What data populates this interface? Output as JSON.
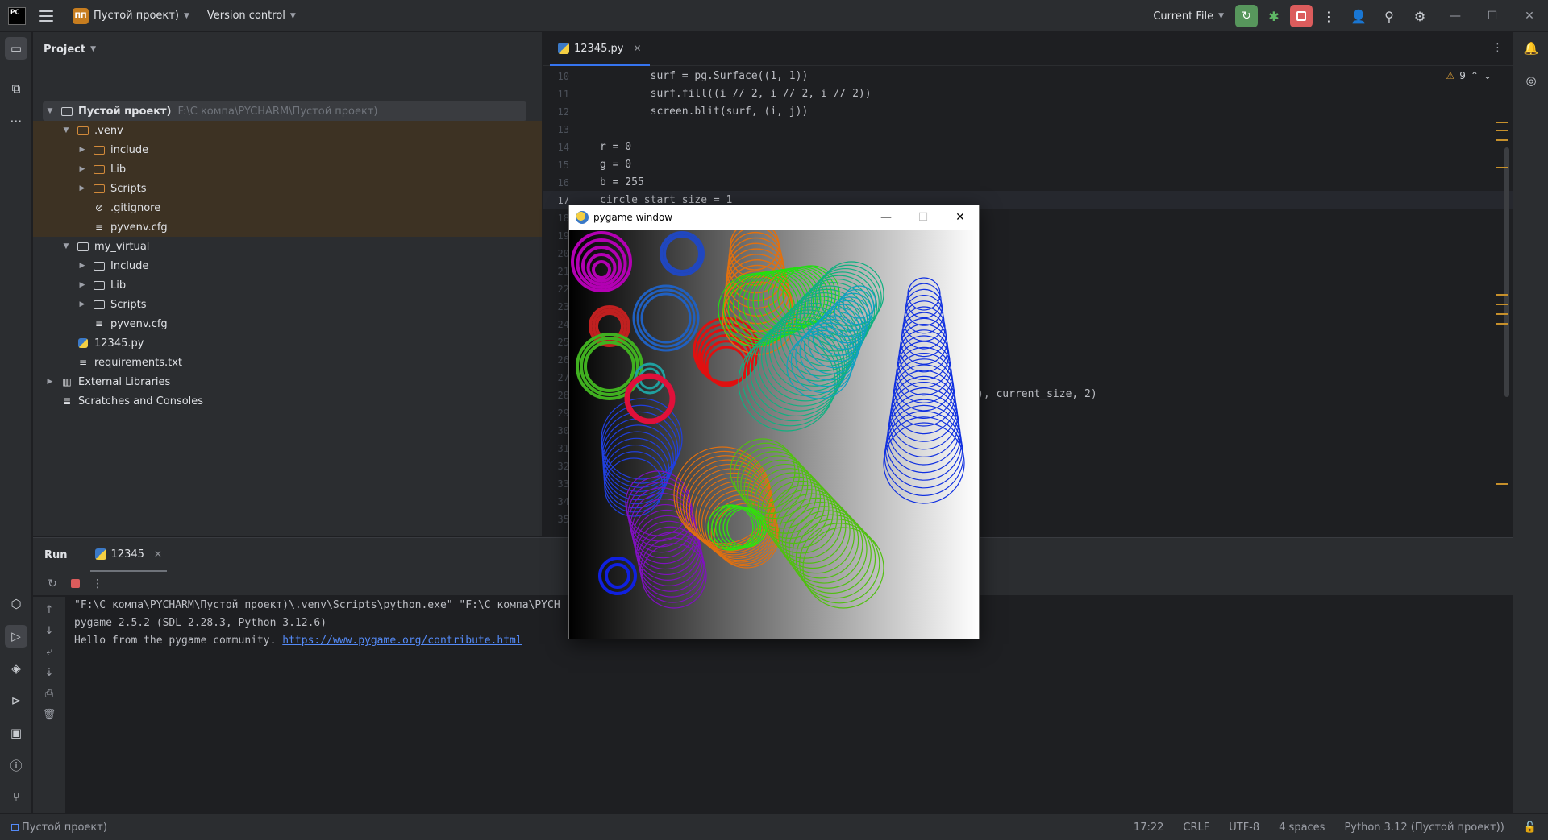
{
  "titlebar": {
    "logo": "PC",
    "project_badge": "ПП",
    "project_name": "Пустой проект)",
    "vcs": "Version control",
    "run_config": "Current File"
  },
  "project_panel": {
    "title": "Project",
    "root": {
      "label": "Пустой проект)",
      "path": "F:\\С компа\\PYCHARM\\Пустой проект)"
    },
    "items": [
      {
        "label": ".venv"
      },
      {
        "label": "include"
      },
      {
        "label": "Lib"
      },
      {
        "label": "Scripts"
      },
      {
        "label": ".gitignore"
      },
      {
        "label": "pyvenv.cfg"
      },
      {
        "label": "my_virtual"
      },
      {
        "label": "Include"
      },
      {
        "label": "Lib"
      },
      {
        "label": "Scripts"
      },
      {
        "label": "pyvenv.cfg"
      },
      {
        "label": "12345.py"
      },
      {
        "label": "requirements.txt"
      },
      {
        "label": "External Libraries"
      },
      {
        "label": "Scratches and Consoles"
      }
    ]
  },
  "editor": {
    "tab": "12345.py",
    "warnings": "9",
    "gutter": [
      "10",
      "11",
      "12",
      "13",
      "14",
      "15",
      "16",
      "17",
      "18",
      "19",
      "20",
      "21",
      "22",
      "23",
      "24",
      "25",
      "26",
      "27",
      "28",
      "29",
      "30",
      "31",
      "32",
      "33",
      "34",
      "35"
    ],
    "lines": [
      "        surf = pg.Surface((1, 1))",
      "        surf.fill((i // 2, i // 2, i // 2))",
      "        screen.blit(surf, (i, j))",
      "",
      "r = 0",
      "g = 0",
      "b = 255",
      "circle_start_size = 1"
    ],
    "partial_line_28": "), current_size, 2)"
  },
  "run": {
    "title": "Run",
    "tab": "12345",
    "console": [
      "\"F:\\С компа\\PYCHARM\\Пустой проект)\\.venv\\Scripts\\python.exe\" \"F:\\С компа\\PYCH",
      "pygame 2.5.2 (SDL 2.28.3, Python 3.12.6)"
    ],
    "hello": "Hello from the pygame community. ",
    "link": "https://www.pygame.org/contribute.html"
  },
  "statusbar": {
    "project": "Пустой проект)",
    "position": "17:22",
    "line_sep": "CRLF",
    "encoding": "UTF-8",
    "indent": "4 spaces",
    "interpreter": "Python 3.12 (Пустой проект))"
  },
  "pygame": {
    "title": "pygame window"
  },
  "colors": {
    "accent": "#3574f0",
    "run_green": "#57965c",
    "stop_red": "#db5c5c",
    "venv_highlight": "#3d3223"
  }
}
